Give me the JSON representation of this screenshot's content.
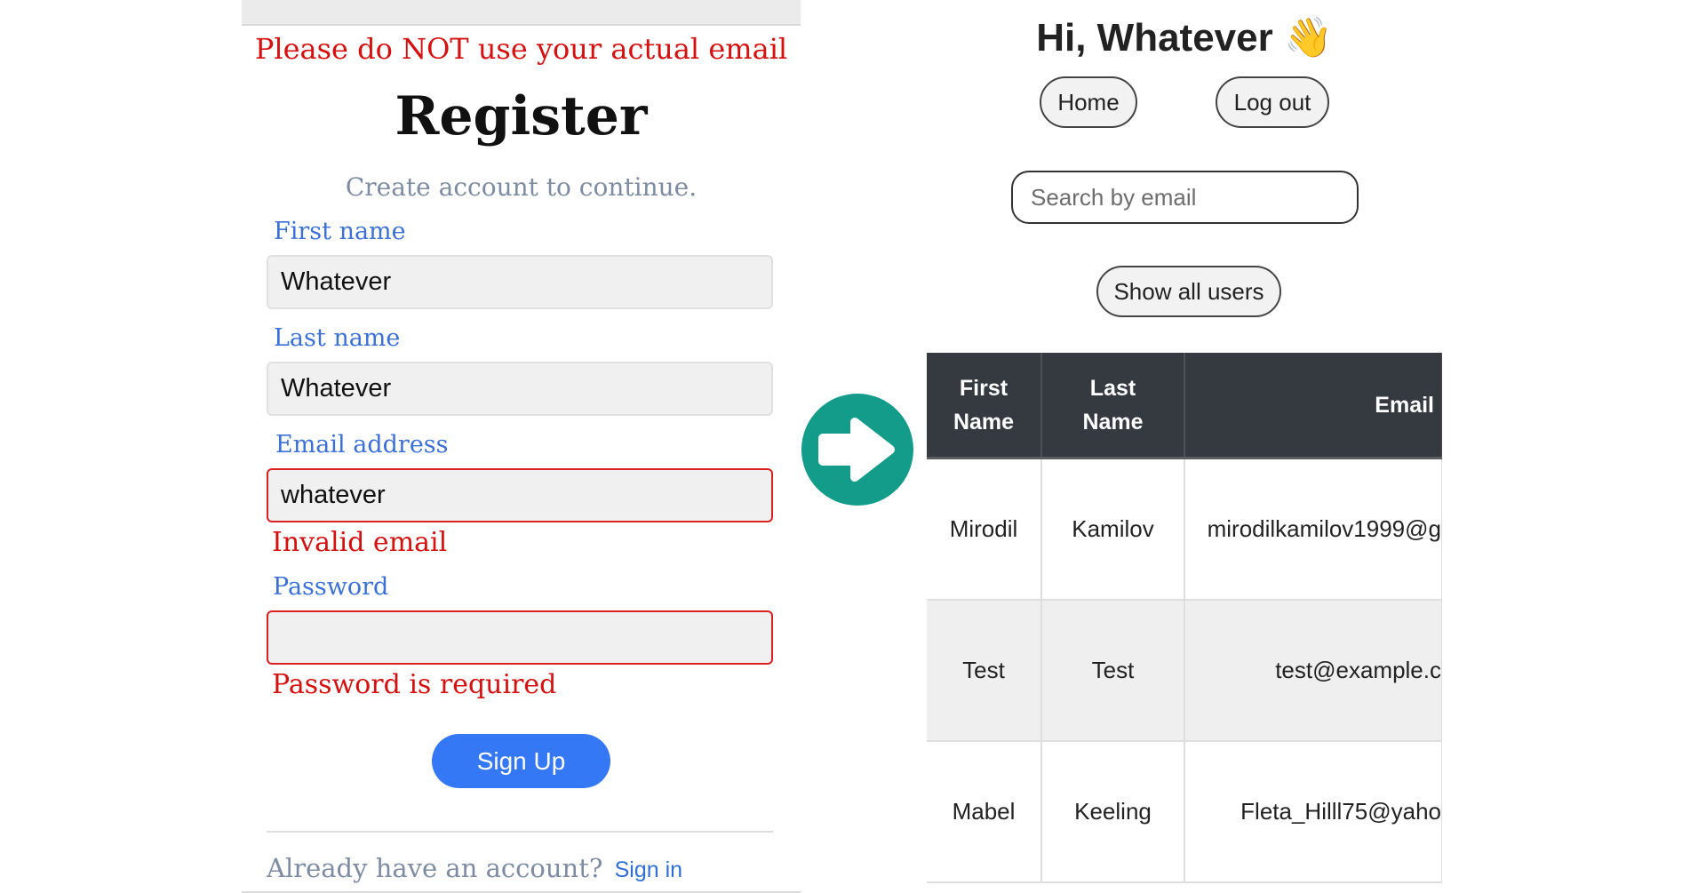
{
  "register": {
    "warning": "Please do NOT use your actual email",
    "title": "Register",
    "subtitle": "Create account to continue.",
    "first_name_label": "First name",
    "first_name_value": "Whatever",
    "last_name_label": "Last name",
    "last_name_value": "Whatever",
    "email_label": "Email address",
    "email_value": "whatever",
    "email_error": "Invalid email",
    "password_label": "Password",
    "password_value": "",
    "password_error": "Password is required",
    "signup_label": "Sign Up",
    "already_text": "Already have an account?",
    "signin_label": "Sign in"
  },
  "users_page": {
    "greeting": "Hi, Whatever 👋",
    "home_label": "Home",
    "logout_label": "Log out",
    "search_placeholder": "Search by email",
    "show_all_label": "Show all users",
    "table": {
      "headers": [
        "First\nName",
        "Last\nName",
        "Email"
      ],
      "rows": [
        [
          "Mirodil",
          "Kamilov",
          "mirodilkamilov1999@g"
        ],
        [
          "Test",
          "Test",
          "test@example.c"
        ],
        [
          "Mabel",
          "Keeling",
          "Fleta_Hilll75@yaho"
        ]
      ]
    }
  },
  "colors": {
    "error": "#d60f0f",
    "label": "#3a70d8",
    "primary": "#3578f6",
    "arrow_circle": "#139c8a",
    "table_header": "#343a40"
  },
  "icons": {
    "arrow": "right-arrow-icon",
    "wave": "waving-hand-emoji"
  }
}
